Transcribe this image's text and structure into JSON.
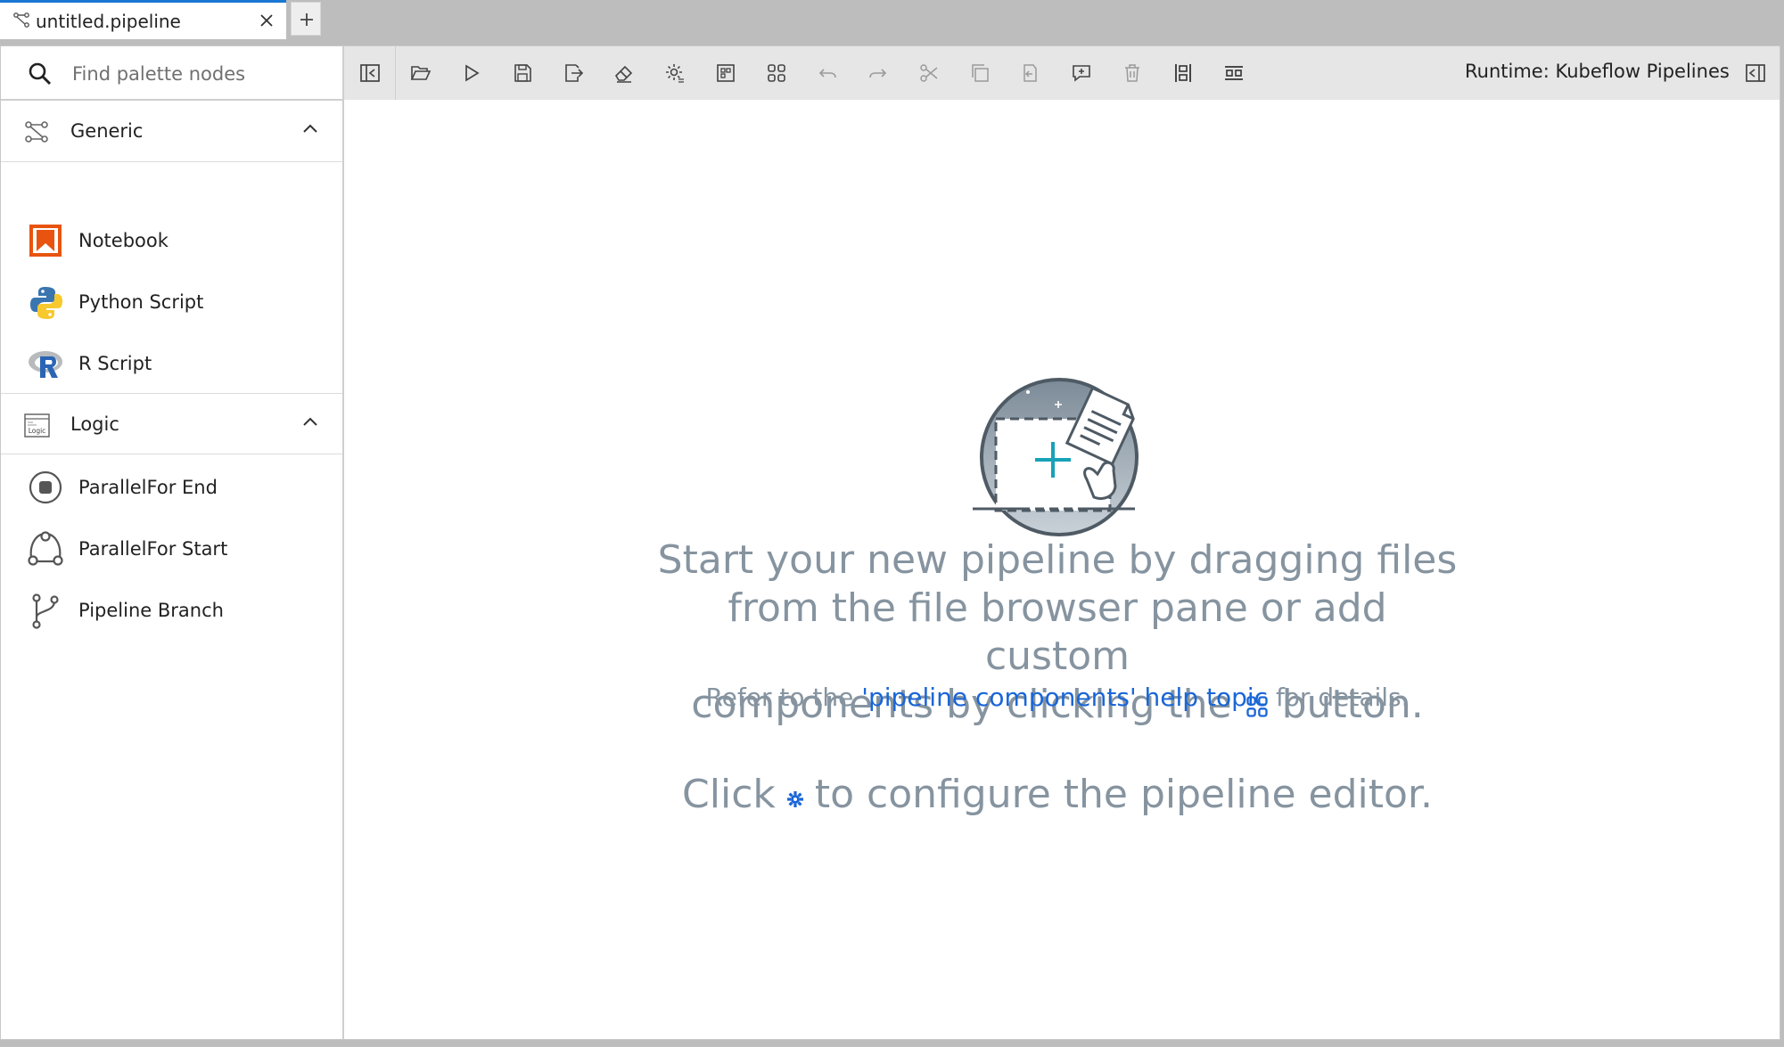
{
  "tab": {
    "title": "untitled.pipeline",
    "add_label": "+"
  },
  "palette": {
    "search_placeholder": "Find palette nodes",
    "categories": [
      {
        "label": "Generic",
        "icon": "pipeline-icon",
        "nodes": [
          {
            "label": "Notebook",
            "icon": "notebook-icon"
          },
          {
            "label": "Python Script",
            "icon": "python-icon"
          },
          {
            "label": "R Script",
            "icon": "r-icon"
          }
        ]
      },
      {
        "label": "Logic",
        "icon": "logic-icon",
        "nodes": [
          {
            "label": "ParallelFor End",
            "icon": "parallelfor-end-icon"
          },
          {
            "label": "ParallelFor Start",
            "icon": "parallelfor-start-icon"
          },
          {
            "label": "Pipeline Branch",
            "icon": "branch-icon"
          }
        ]
      }
    ]
  },
  "toolbar": {
    "runtime": "Runtime: Kubeflow Pipelines",
    "buttons": [
      "toggle-palette",
      "open-panel",
      "run",
      "save",
      "export",
      "clear",
      "settings",
      "open-runtimes",
      "add-components",
      "undo",
      "redo",
      "cut",
      "copy",
      "paste",
      "add-comment",
      "delete",
      "arrange-vertically",
      "arrange-horizontally",
      "toggle-properties"
    ]
  },
  "empty_state": {
    "line1": "Start your new pipeline by dragging files",
    "line2": "from the file browser pane or add custom",
    "line3_before": "components by clicking the",
    "line3_after": "button.",
    "refer_before": "Refer to the",
    "refer_link": "'pipeline components' help topic",
    "refer_after": "for details.",
    "configure_before": "Click",
    "configure_after": "to configure the pipeline editor."
  },
  "colors": {
    "accent": "#1976d2",
    "link": "#1a66d6",
    "empty_text": "#8694a0",
    "toolbar_bg": "#e6e6e6",
    "illustration_teal": "#17a2b8"
  }
}
